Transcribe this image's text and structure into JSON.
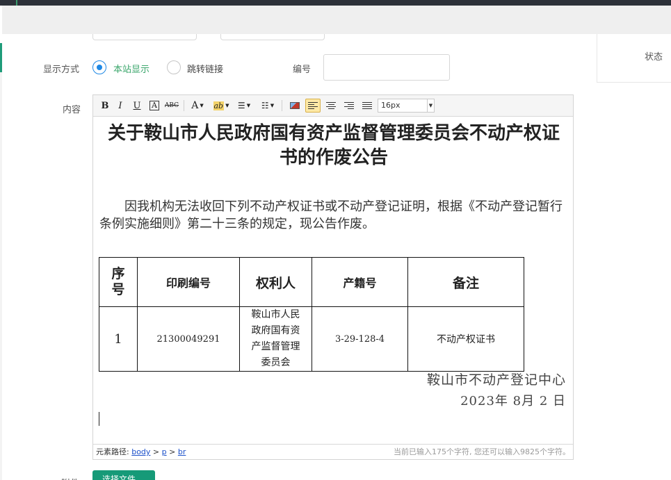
{
  "header": {},
  "right_panel": {
    "status_label": "状态"
  },
  "form": {
    "display_mode_label": "显示方式",
    "display_options": [
      {
        "label": "本站显示",
        "checked": true
      },
      {
        "label": "跳转链接",
        "checked": false
      }
    ],
    "number_label": "编号",
    "number_value": "",
    "content_label": "内容",
    "bottom_label": "附件",
    "upload_button": "选择文件"
  },
  "editor": {
    "toolbar": {
      "bold": "B",
      "italic": "I",
      "underline": "U",
      "font_border": "A",
      "strike": "ABC",
      "font_color": "A",
      "highlight": "ab",
      "font_size": "16px"
    },
    "document": {
      "title": "关于鞍山市人民政府国有资产监督管理委员会不动产权证书的作废公告",
      "paragraph": "因我机构无法收回下列不动产权证书或不动产登记证明，根据《不动产登记暂行条例实施细则》第二十三条的规定，现公告作废。",
      "table": {
        "headers": [
          "序号",
          "印刷编号",
          "权利人",
          "产籍号",
          "备注"
        ],
        "rows": [
          [
            "1",
            "21300049291",
            "鞍山市人民政府国有资产监督管理委员会",
            "3-29-128-4",
            "不动产权证书"
          ]
        ]
      },
      "signature": "鞍山市不动产登记中心",
      "date": "2023年 8月 2 日"
    },
    "status": {
      "path_label": "元素路径:",
      "path": [
        "body",
        "p",
        "br"
      ],
      "counter": "当前已输入175个字符, 您还可以输入9825个字符。"
    }
  },
  "colors": {
    "accent": "#169a78",
    "radio": "#1e88e5",
    "topbar": "#2d3139"
  }
}
